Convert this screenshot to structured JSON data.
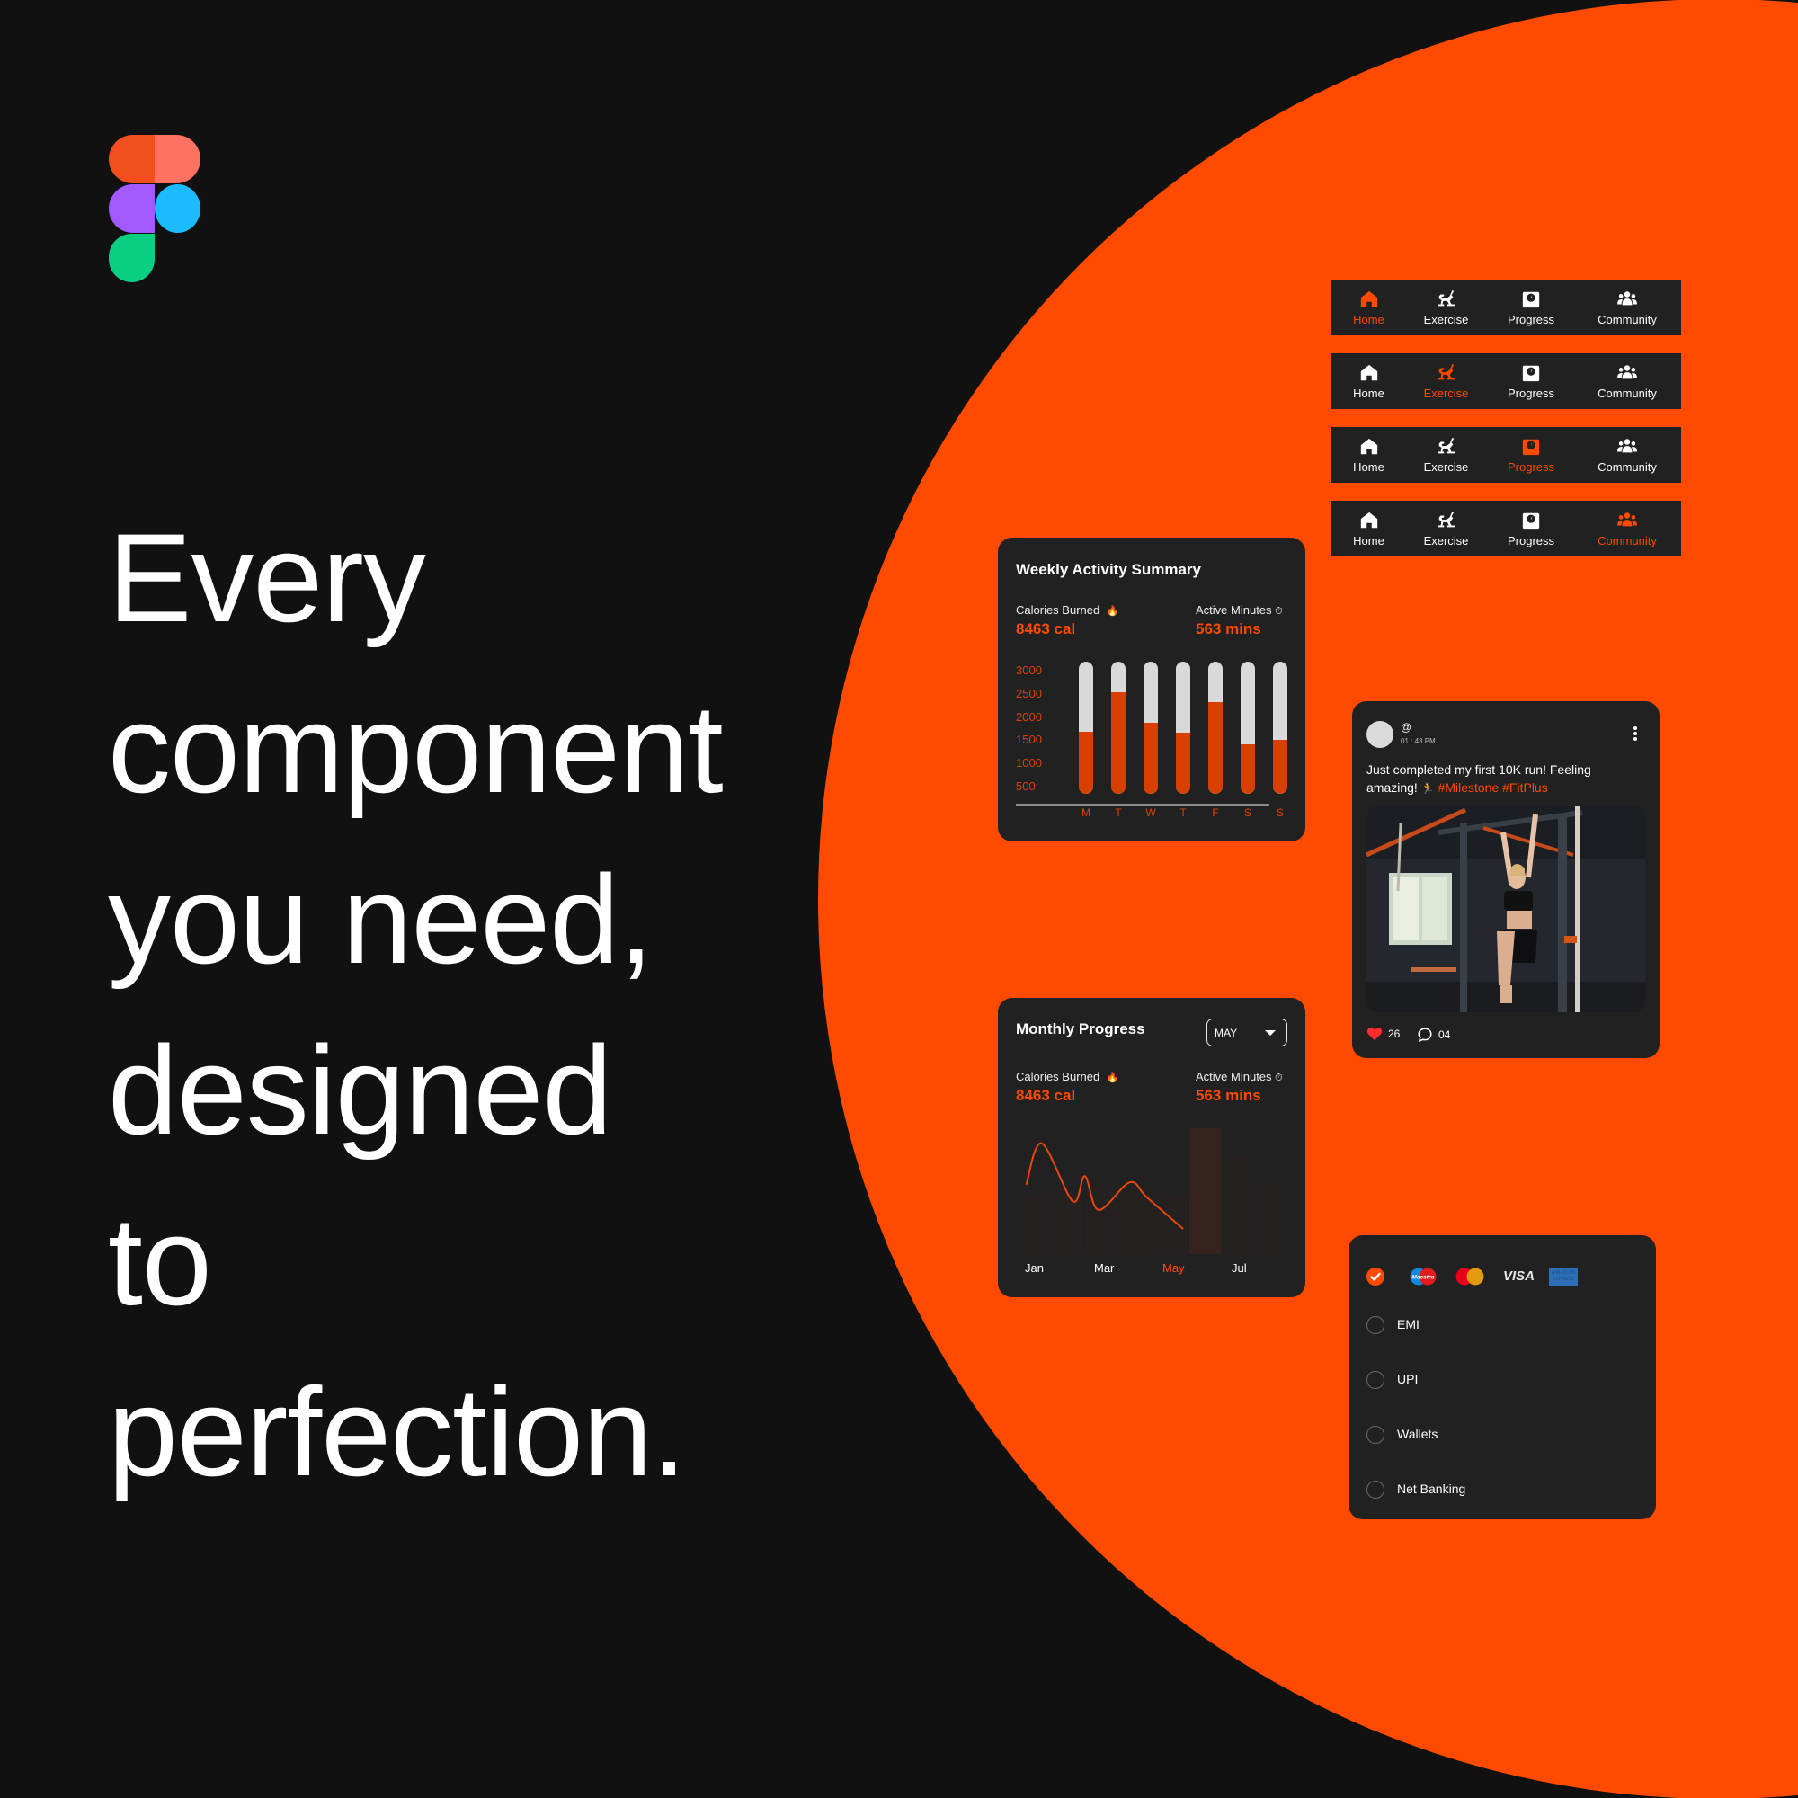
{
  "headline": {
    "lines": [
      "Every",
      "component",
      "you need,",
      "designed",
      "to",
      "perfection."
    ]
  },
  "colors": {
    "accent": "#FF4A00",
    "background": "#111111",
    "card": "#212121",
    "bar_track": "#D9D9D9",
    "bar_fill": "#D94000"
  },
  "logo": {
    "name": "figma-logo"
  },
  "nav_bars": [
    {
      "active": 0,
      "items": [
        {
          "label": "Home",
          "icon": "home-icon"
        },
        {
          "label": "Exercise",
          "icon": "exercise-bike-icon"
        },
        {
          "label": "Progress",
          "icon": "scale-icon"
        },
        {
          "label": "Community",
          "icon": "community-icon"
        }
      ]
    },
    {
      "active": 1,
      "items": [
        {
          "label": "Home",
          "icon": "home-icon"
        },
        {
          "label": "Exercise",
          "icon": "exercise-bike-icon"
        },
        {
          "label": "Progress",
          "icon": "scale-icon"
        },
        {
          "label": "Community",
          "icon": "community-icon"
        }
      ]
    },
    {
      "active": 2,
      "items": [
        {
          "label": "Home",
          "icon": "home-icon"
        },
        {
          "label": "Exercise",
          "icon": "exercise-bike-icon"
        },
        {
          "label": "Progress",
          "icon": "scale-icon"
        },
        {
          "label": "Community",
          "icon": "community-icon"
        }
      ]
    },
    {
      "active": 3,
      "items": [
        {
          "label": "Home",
          "icon": "home-icon"
        },
        {
          "label": "Exercise",
          "icon": "exercise-bike-icon"
        },
        {
          "label": "Progress",
          "icon": "scale-icon"
        },
        {
          "label": "Community",
          "icon": "community-icon"
        }
      ]
    }
  ],
  "weekly": {
    "title": "Weekly Activity Summary",
    "calories_label": "Calories Burned",
    "calories_emoji": "🔥",
    "calories_value": "8463 cal",
    "minutes_label": "Active Minutes",
    "minutes_emoji": "⏱",
    "minutes_value": "563 mins"
  },
  "monthly": {
    "title": "Monthly Progress",
    "dropdown_value": "MAY",
    "calories_label": "Calories Burned",
    "calories_emoji": "🔥",
    "calories_value": "8463 cal",
    "minutes_label": "Active Minutes",
    "minutes_emoji": "⏱",
    "minutes_value": "563 mins"
  },
  "chart_data": [
    {
      "type": "bar",
      "title": "Weekly Activity Summary",
      "categories": [
        "M",
        "T",
        "W",
        "T",
        "F",
        "S",
        "S"
      ],
      "values": [
        1680,
        2540,
        1880,
        1660,
        2320,
        1410,
        1510
      ],
      "yticks": [
        "3000",
        "2500",
        "2000",
        "1500",
        "1000",
        "500"
      ],
      "ylim": [
        350,
        3200
      ],
      "xlabel": "",
      "ylabel": "",
      "grid": false
    },
    {
      "type": "line",
      "title": "Monthly Progress",
      "xtick_labels": [
        "Jan",
        "Mar",
        "May",
        "Jul"
      ],
      "active_label": "May",
      "columns": 8,
      "highlight_column": 5,
      "column_values": [
        0.46,
        0.48,
        0.52,
        0.55,
        0.46,
        1.0,
        0.78,
        0.55
      ],
      "line_points": [
        [
          0.0,
          0.55
        ],
        [
          0.45,
          0.88
        ],
        [
          1.35,
          0.42
        ],
        [
          1.7,
          0.62
        ],
        [
          2.1,
          0.35
        ],
        [
          3.0,
          0.57
        ],
        [
          3.5,
          0.45
        ],
        [
          4.55,
          0.2
        ]
      ],
      "x_range": [
        0,
        8
      ],
      "y_range": [
        0,
        1
      ]
    }
  ],
  "post": {
    "handle": "@",
    "time": "01 : 43 PM",
    "text": "Just completed my first 10K run! Feeling amazing! ",
    "emoji": "🏃",
    "tags": "#Milestone #FitPlus",
    "likes": "26",
    "comments": "04"
  },
  "payment": {
    "card_brands": [
      "Maestro",
      "Mastercard",
      "VISA",
      "American Express"
    ],
    "visa_text": "VISA",
    "maestro_text": "Maestro",
    "amex_text": "AMERICAN EXPRESS",
    "options": [
      "EMI",
      "UPI",
      "Wallets",
      "Net Banking"
    ],
    "selected": "cards"
  }
}
